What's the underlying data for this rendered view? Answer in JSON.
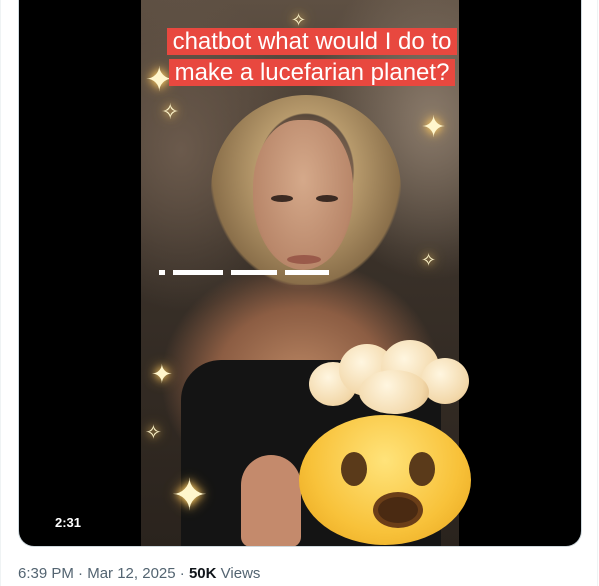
{
  "video": {
    "caption": "chatbot what would I do to make a lucefarian planet?",
    "duration": "2:31",
    "emoji": "exploding-head-emoji"
  },
  "tweet": {
    "time": "6:39 PM",
    "separator": "·",
    "date": "Mar 12, 2025",
    "views_count": "50K",
    "views_label": "Views"
  },
  "colors": {
    "caption_bg": "#e8483f",
    "meta_text": "#536471",
    "views_count": "#0f1419"
  }
}
